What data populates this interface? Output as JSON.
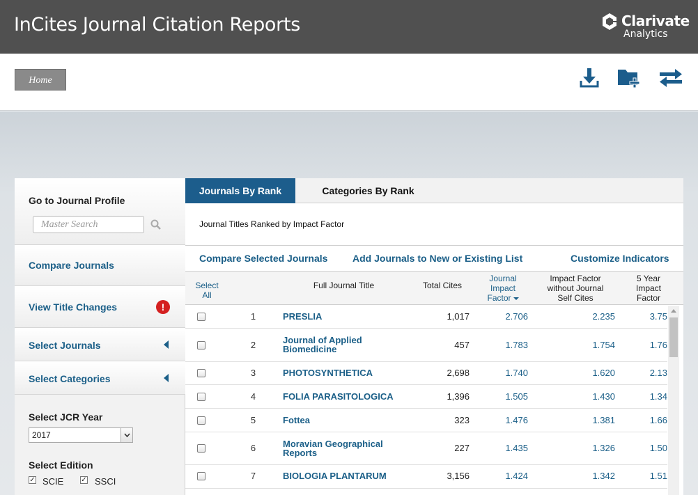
{
  "header": {
    "title": "InCites Journal Citation Reports",
    "brand_name": "Clarivate",
    "brand_sub": "Analytics"
  },
  "toolbar": {
    "home_label": "Home",
    "icons": [
      "download-icon",
      "add-folder-icon",
      "switch-arrows-icon"
    ],
    "icon_color": "#1c5d8c"
  },
  "sidebar": {
    "profile_heading": "Go to Journal Profile",
    "search_placeholder": "Master Search",
    "compare_label": "Compare Journals",
    "title_changes_label": "View Title Changes",
    "alert_symbol": "!",
    "select_journals_label": "Select Journals",
    "select_categories_label": "Select Categories",
    "jcr_year_heading": "Select JCR Year",
    "jcr_year_value": "2017",
    "edition_heading": "Select Edition",
    "editions": [
      {
        "label": "SCIE",
        "checked": true
      },
      {
        "label": "SSCI",
        "checked": true
      }
    ]
  },
  "tabs": {
    "active": "Journals By Rank",
    "other": "Categories By Rank"
  },
  "main": {
    "ranked_caption": "Journal Titles Ranked by Impact Factor",
    "actions": {
      "compare": "Compare Selected Journals",
      "add_list": "Add Journals to New or Existing List",
      "customize": "Customize Indicators"
    }
  },
  "table": {
    "headers": {
      "select_all_line1": "Select",
      "select_all_line2": "All",
      "title": "Full Journal Title",
      "total_cites": "Total Cites",
      "jif_line1": "Journal",
      "jif_line2": "Impact",
      "jif_line3": "Factor",
      "ifws_line1": "Impact Factor",
      "ifws_line2": "without Journal",
      "ifws_line3": "Self Cites",
      "y5_line1": "5 Year",
      "y5_line2": "Impact",
      "y5_line3": "Factor"
    },
    "rows": [
      {
        "rank": "1",
        "title": "PRESLIA",
        "cites": "1,017",
        "jif": "2.706",
        "ifws": "2.235",
        "y5": "3.75"
      },
      {
        "rank": "2",
        "title": "Journal of Applied Biomedicine",
        "cites": "457",
        "jif": "1.783",
        "ifws": "1.754",
        "y5": "1.76"
      },
      {
        "rank": "3",
        "title": "PHOTOSYNTHETICA",
        "cites": "2,698",
        "jif": "1.740",
        "ifws": "1.620",
        "y5": "2.13"
      },
      {
        "rank": "4",
        "title": "FOLIA PARASITOLOGICA",
        "cites": "1,396",
        "jif": "1.505",
        "ifws": "1.430",
        "y5": "1.34"
      },
      {
        "rank": "5",
        "title": "Fottea",
        "cites": "323",
        "jif": "1.476",
        "ifws": "1.381",
        "y5": "1.66"
      },
      {
        "rank": "6",
        "title": "Moravian Geographical Reports",
        "cites": "227",
        "jif": "1.435",
        "ifws": "1.326",
        "y5": "1.50"
      },
      {
        "rank": "7",
        "title": "BIOLOGIA PLANTARUM",
        "cites": "3,156",
        "jif": "1.424",
        "ifws": "1.342",
        "y5": "1.51"
      }
    ]
  },
  "colors": {
    "header_bg": "#505050",
    "accent": "#1c5d8c",
    "alert": "#d42020"
  }
}
